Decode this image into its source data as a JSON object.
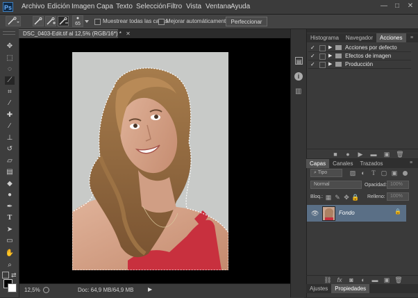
{
  "app": {
    "logo": "Ps"
  },
  "menu": [
    "Archivo",
    "Edición",
    "Imagen",
    "Capa",
    "Texto",
    "Selección",
    "Filtro",
    "Vista",
    "Ventana",
    "Ayuda"
  ],
  "window_controls": {
    "minimize": "—",
    "maximize": "□",
    "close": "✕"
  },
  "options_bar": {
    "brush_size": "65",
    "sample_all_layers": "Muestrear todas las capas",
    "auto_enhance": "Mejorar automáticamente",
    "refine_edge": "Perfeccionar bor."
  },
  "document": {
    "tab_title": "DSC_0403-Edit.tif al 12,5% (RGB/16*) *",
    "close": "✕"
  },
  "status": {
    "zoom": "12,5%",
    "doc_info": "Doc: 64,9 MB/64,9 MB"
  },
  "panels": {
    "top_tabs": [
      "Histograma",
      "Navegador",
      "Acciones"
    ],
    "actions": [
      "Acciones por defecto",
      "Efectos de imagen",
      "Producción"
    ],
    "layer_tabs": [
      "Capas",
      "Canales",
      "Trazados"
    ],
    "filter_type": "Tipo",
    "blend_mode": "Normal",
    "opacity_label": "Opacidad:",
    "opacity_value": "100%",
    "lock_label": "Bloq.:",
    "fill_label": "Relleno:",
    "fill_value": "100%",
    "layer_name": "Fondo",
    "bottom_tabs": [
      "Ajustes",
      "Propiedades"
    ]
  },
  "colors": {
    "accent_selected_layer": "#5a6f86",
    "canvas_bg": "#000000"
  }
}
